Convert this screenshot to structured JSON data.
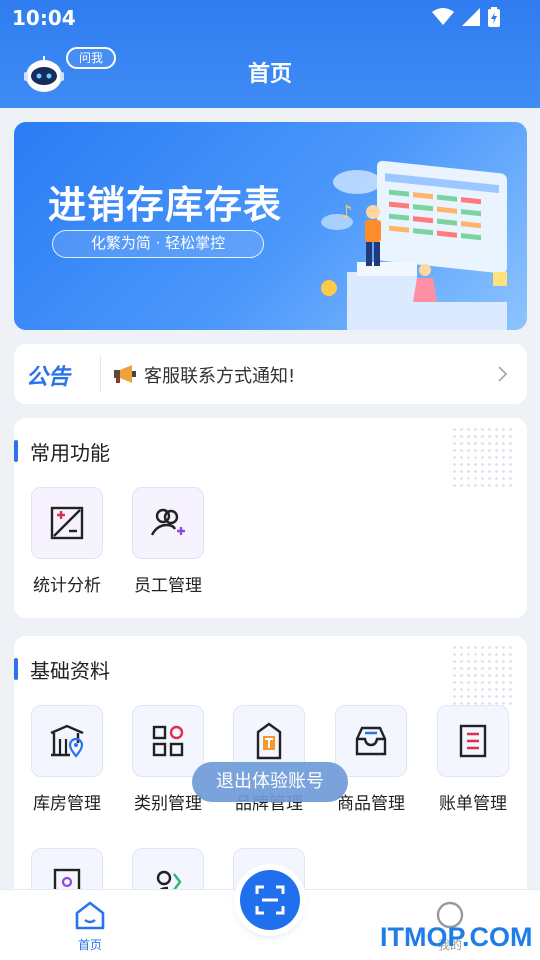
{
  "status_bar": {
    "time": "10:04"
  },
  "header": {
    "title": "首页",
    "ask_label": "问我"
  },
  "banner": {
    "title": "进销存库存表",
    "subtitle": "化繁为简 · 轻松掌控"
  },
  "notice": {
    "tag": "公告",
    "text": "客服联系方式通知!"
  },
  "common_section": {
    "title": "常用功能",
    "items": [
      {
        "label": "统计分析",
        "icon": "stats-icon"
      },
      {
        "label": "员工管理",
        "icon": "add-employee-icon"
      }
    ]
  },
  "basic_section": {
    "title": "基础资料",
    "items": [
      {
        "label": "库房管理",
        "icon": "warehouse-icon"
      },
      {
        "label": "类别管理",
        "icon": "category-icon"
      },
      {
        "label": "品牌管理",
        "icon": "brand-tag-icon"
      },
      {
        "label": "商品管理",
        "icon": "inbox-icon"
      },
      {
        "label": "账单管理",
        "icon": "bill-icon"
      }
    ]
  },
  "toast": {
    "text": "退出体验账号"
  },
  "bottom_nav": {
    "home_label": "首页",
    "mine_label": "我的"
  },
  "watermark": "ITMOP.COM",
  "colors": {
    "primary": "#2a73ea",
    "header": "#2f7cf0",
    "background": "#eef1f6"
  }
}
